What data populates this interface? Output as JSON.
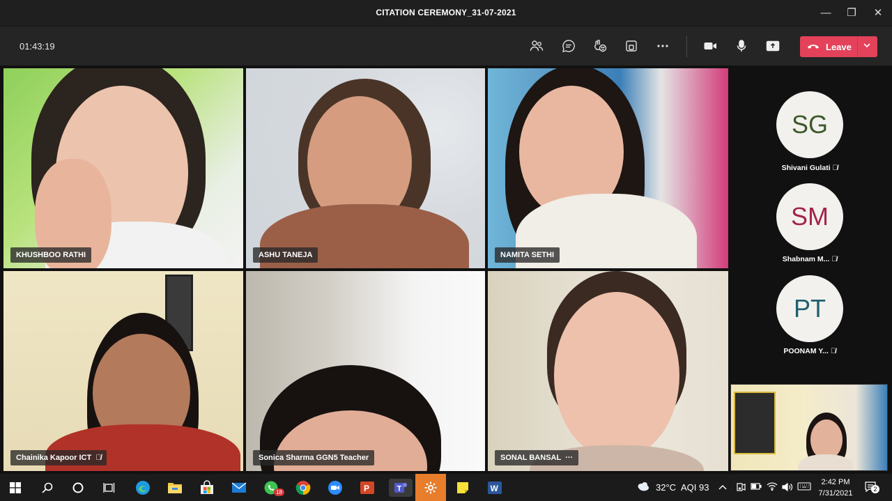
{
  "window": {
    "title": "CITATION CEREMONY_31-07-2021",
    "minimize_glyph": "—",
    "restore_glyph": "❐",
    "close_glyph": "✕"
  },
  "toolbar": {
    "timer": "01:43:19",
    "leave_label": "Leave",
    "icons": [
      "participants-icon",
      "chat-icon",
      "reactions-icon",
      "rooms-icon",
      "more-options-icon",
      "camera-icon",
      "microphone-icon",
      "share-screen-icon"
    ]
  },
  "tiles": [
    {
      "name": "KHUSHBOO RATHI",
      "muted": false
    },
    {
      "name": "ASHU TANEJA",
      "muted": false
    },
    {
      "name": "NAMITA SETHI",
      "muted": false
    },
    {
      "name": "Chainika Kapoor ICT",
      "muted": true
    },
    {
      "name": "Sonica Sharma GGN5 Teacher",
      "muted": false
    },
    {
      "name": "SONAL BANSAL",
      "muted": false,
      "more": "···"
    }
  ],
  "side_participants": [
    {
      "initials": "SG",
      "name": "Shivani Gulati",
      "color": "#3d5a2a"
    },
    {
      "initials": "SM",
      "name": "Shabnam M...",
      "color": "#a3244a"
    },
    {
      "initials": "PT",
      "name": "POONAM Y...",
      "color": "#1f5f6f"
    }
  ],
  "taskbar": {
    "whatsapp_badge": "18",
    "weather": "32°C",
    "aqi": "AQI 93",
    "time": "2:42 PM",
    "date": "7/31/2021",
    "notifications": "2"
  }
}
